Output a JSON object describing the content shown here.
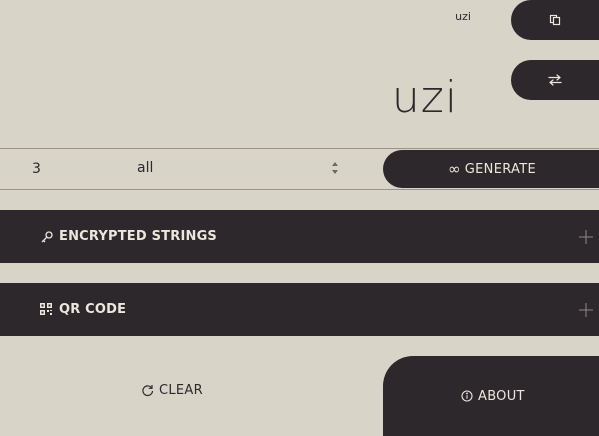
{
  "header": {
    "small_word": "uzi",
    "title": "uzi"
  },
  "top_buttons": [
    {
      "icon": "copy-icon"
    },
    {
      "icon": "swap-arrows-icon"
    }
  ],
  "controls": {
    "count_value": "3",
    "select_value": "all",
    "generate_label": "GENERATE",
    "generate_icon": "∞"
  },
  "sections": [
    {
      "label": "ENCRYPTED STRINGS",
      "icon": "key-icon"
    },
    {
      "label": "QR CODE",
      "icon": "qr-code-icon"
    }
  ],
  "footer": {
    "clear_label": "CLEAR",
    "about_label": "ABOUT"
  },
  "colors": {
    "background": "#d9d4c8",
    "dark": "#2d282b",
    "light_text": "#ece7dc"
  }
}
